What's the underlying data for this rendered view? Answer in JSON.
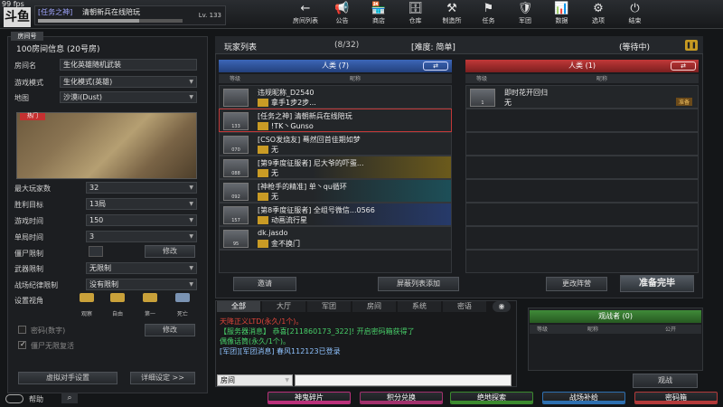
{
  "fps": "99 fps",
  "logo": "斗鱼",
  "user": {
    "clan": "[任务之神]",
    "name": "清朝新兵在线陪玩",
    "level": "Lv. 133",
    "xp_fraction": 0.7
  },
  "nav": [
    {
      "icon": "arrow-left-icon",
      "glyph": "←",
      "label": "房间列表"
    },
    {
      "icon": "megaphone-icon",
      "glyph": "📢",
      "label": "公告"
    },
    {
      "icon": "shop-icon",
      "glyph": "🏪",
      "label": "商店"
    },
    {
      "icon": "warehouse-icon",
      "glyph": "🗄",
      "label": "仓库"
    },
    {
      "icon": "workshop-icon",
      "glyph": "⚒",
      "label": "制造所"
    },
    {
      "icon": "mission-icon",
      "glyph": "⚑",
      "label": "任务"
    },
    {
      "icon": "clan-icon",
      "glyph": "🛡",
      "label": "军团"
    },
    {
      "icon": "data-icon",
      "glyph": "📊",
      "label": "数据"
    },
    {
      "icon": "gear-icon",
      "glyph": "⚙",
      "label": "选项"
    },
    {
      "icon": "power-icon",
      "glyph": "⏻",
      "label": "结束"
    }
  ],
  "room": {
    "tab": "房间号",
    "title": "100房间信息 (20号房)",
    "fields": [
      {
        "label": "房间名",
        "value": "生化英雄随机武装"
      },
      {
        "label": "游戏模式",
        "value": "生化模式(英雄)"
      },
      {
        "label": "地图",
        "value": "沙漠ⅰ(Dust)"
      }
    ],
    "hot_badge": "热门",
    "settings": [
      {
        "label": "最大玩家数",
        "value": "32"
      },
      {
        "label": "胜利目标",
        "value": "13局"
      },
      {
        "label": "游戏时间",
        "value": "150"
      },
      {
        "label": "单局时间",
        "value": "3"
      }
    ],
    "zombie_limit_label": "僵尸限制",
    "zombie_limit_btn": "修改",
    "weapon_limit": {
      "label": "武器限制",
      "value": "无限制"
    },
    "discipline": {
      "label": "战场纪律限制",
      "value": "没有限制"
    },
    "view_label": "设置视角",
    "views": [
      "观察",
      "自由",
      "第一",
      "死亡"
    ],
    "password_label": "密码(数字)",
    "password_btn": "修改",
    "zombie_unlimited_label": "僵尸无限复活",
    "bot_btn": "虚拟对手设置",
    "detail_btn": "详细设定 >>"
  },
  "player_list": {
    "title": "玩家列表",
    "count": "(8/32)",
    "difficulty": "[难度: 简单]",
    "status": "(等待中)",
    "human_team": "人类 (7)",
    "zombie_team": "人类 (1)",
    "col_level": "等级",
    "col_name": "昵称",
    "human_players": [
      {
        "rank": "",
        "name": "违规昵称_D2540",
        "clan": "拿手1步2步..."
      },
      {
        "rank": "133",
        "name": "[任务之神] 清朝新兵在线陪玩",
        "clan": "!TK丶Gunso"
      },
      {
        "rank": "070",
        "name": "[CSO发烧友] 蓦然回首佳期如梦",
        "clan": "无"
      },
      {
        "rank": "088",
        "name": "[第9季度征服者] 尼大爷的吓蛋...",
        "clan": "无"
      },
      {
        "rank": "092",
        "name": "[神枪手的精准] 单丶qu循环",
        "clan": "无"
      },
      {
        "rank": "157",
        "name": "[第8季度征服者] 全组号微信...0566",
        "clan": "动画流行星"
      },
      {
        "rank": "95",
        "name": "dk.jasdo",
        "clan": "金不换门"
      }
    ],
    "zombie_players": [
      {
        "rank": "1",
        "name": "即时花开回归",
        "clan": "无",
        "badge": "准备"
      }
    ],
    "invite_btn": "邀请",
    "block_btn": "屏蔽列表添加",
    "change_team_btn": "更改阵营",
    "ready_btn": "准备完毕"
  },
  "chat": {
    "tabs": [
      "全部",
      "大厅",
      "军团",
      "房间",
      "系统",
      "密语"
    ],
    "lines": [
      {
        "text": "天降正义LTD(永久/1个)。",
        "color": "#e0453a"
      },
      {
        "text": "【服务器消息】 恭喜[211860173_322]! 开启密码箱获得了",
        "color": "#48d06a"
      },
      {
        "text": "偶像话筒(永久/1个)。",
        "color": "#48d06a"
      },
      {
        "text": "[军团][军团消息] 春风112123已登录",
        "color": "#8fc3ff"
      }
    ],
    "channel": "房间",
    "input_placeholder": ""
  },
  "spectators": {
    "title": "观战者 (0)",
    "col_level": "等级",
    "col_name": "昵称",
    "col_extra": "公开",
    "watch_btn": "观战"
  },
  "bottom": {
    "help": "帮助",
    "buttons": [
      {
        "label": "神鬼碎片",
        "color": "#b9307a"
      },
      {
        "label": "积分兑换",
        "color": "#a0306c"
      },
      {
        "label": "绝地探索",
        "color": "#3b8a2e"
      },
      {
        "label": "战场补给",
        "color": "#2d6fb0"
      },
      {
        "label": "密码箱",
        "color": "#b33a3a"
      }
    ]
  }
}
